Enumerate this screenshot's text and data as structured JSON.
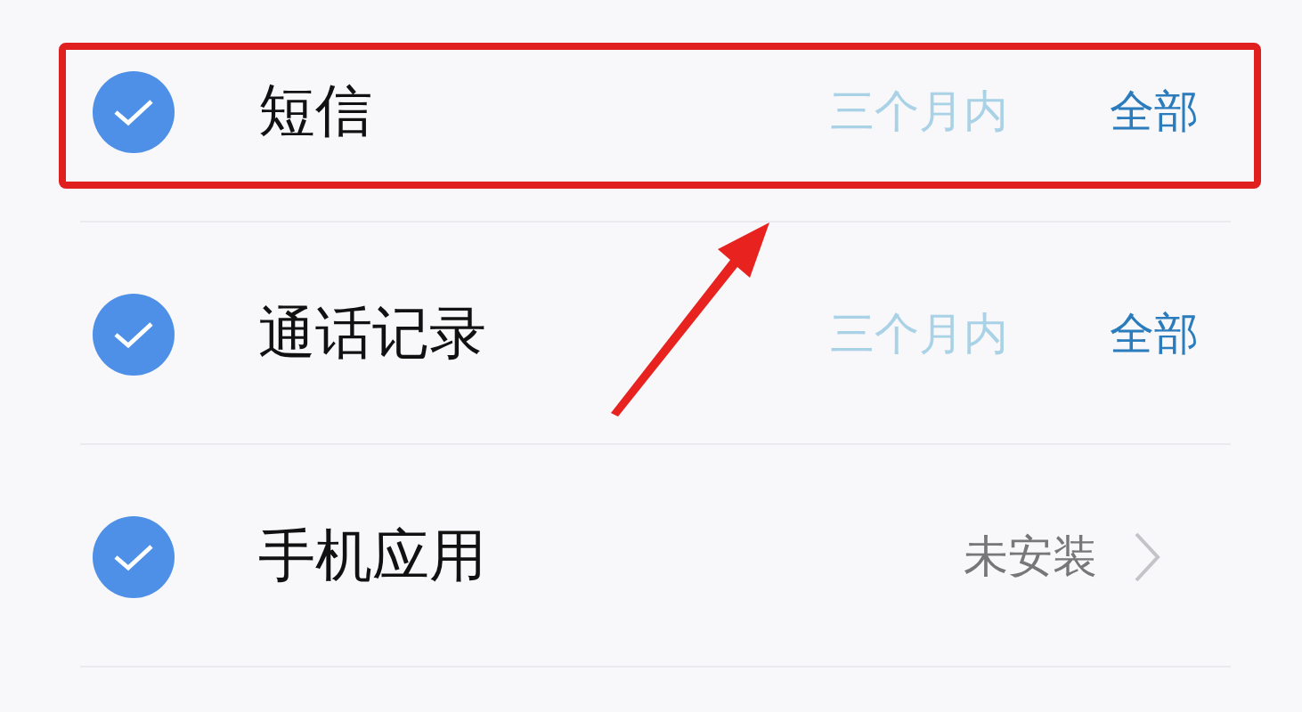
{
  "rows": [
    {
      "kind": "range",
      "title": "短信",
      "checked": true,
      "highlighted": true,
      "range": "三个月内",
      "action": "全部"
    },
    {
      "kind": "range",
      "title": "通话记录",
      "checked": true,
      "highlighted": false,
      "range": "三个月内",
      "action": "全部"
    },
    {
      "kind": "status",
      "title": "手机应用",
      "checked": true,
      "highlighted": false,
      "status": "未安装"
    }
  ]
}
